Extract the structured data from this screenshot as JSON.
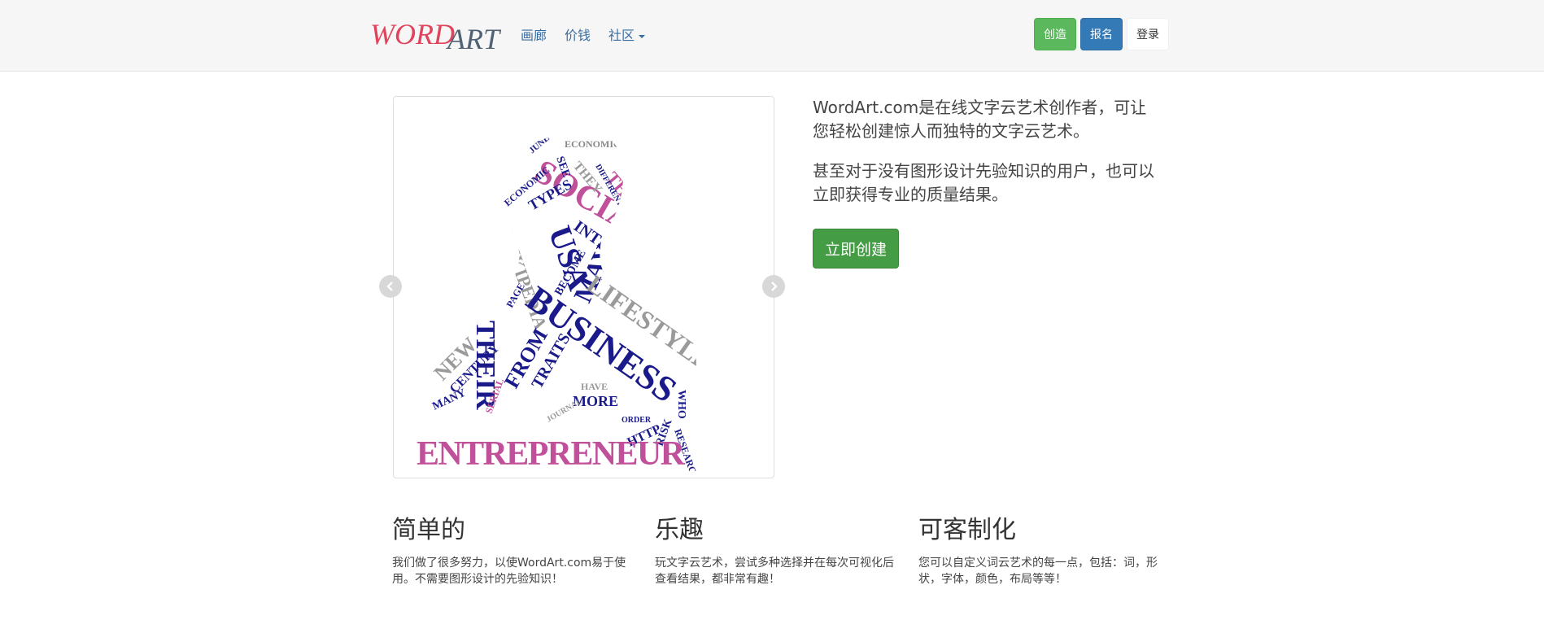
{
  "brand": {
    "logo_word": "WORD",
    "logo_art": "ART",
    "colors": {
      "logo_red": "#e0445c",
      "logo_slate": "#4f6276"
    }
  },
  "nav": {
    "links": [
      "画廊",
      "价钱",
      "社区"
    ],
    "create_label": "创造",
    "signup_label": "报名",
    "login_label": "登录",
    "colors": {
      "create": "#5cb85c",
      "signup": "#337ab7",
      "link": "#3a6d9e"
    }
  },
  "carousel": {
    "prev_icon": "chevron-left-icon",
    "next_icon": "chevron-right-icon",
    "image_words": [
      "ENTREPRENEUR",
      "BUSINESS",
      "SOCIAL",
      "USA",
      "THEIR",
      "MAY",
      "INTERNET",
      "LIFESTYLE",
      "NEW",
      "CENTURY",
      "FROM",
      "TRAITS",
      "MORE",
      "HTTP",
      "RISK",
      "RESEARCH",
      "WHO",
      "TYPES",
      "PROFIT",
      "THERE",
      "WIKIPEDIA",
      "BECOME",
      "PAGE",
      "MANY",
      "SERIAL",
      "HAVE",
      "ORDER",
      "JOURNAL",
      "SEE",
      "JUNE",
      "ECONOMIC",
      "DIFFERENT",
      "THEY"
    ]
  },
  "hero": {
    "paragraph1": "WordArt.com是在线文字云艺术创作者，可让您轻松创建惊人而独特的文字云艺术。",
    "paragraph2": "甚至对于没有图形设计先验知识的用户，也可以立即获得专业的质量结果。",
    "cta_label": "立即创建",
    "cta_color": "#449d44"
  },
  "features": [
    {
      "title": "简单的",
      "text": "我们做了很多努力，以使WordArt.com易于使用。不需要图形设计的先验知识！"
    },
    {
      "title": "乐趣",
      "text": "玩文字云艺术，尝试多种选择并在每次可视化后查看结果，都非常有趣！"
    },
    {
      "title": "可客制化",
      "text": "您可以自定义词云艺术的每一点，包括：词，形状，字体，颜色，布局等等！"
    }
  ]
}
